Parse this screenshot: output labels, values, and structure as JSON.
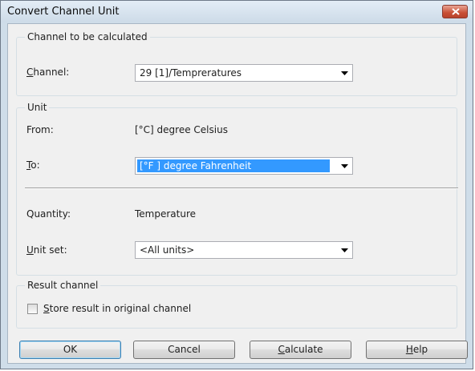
{
  "window": {
    "title": "Convert Channel Unit"
  },
  "channel_group": {
    "legend": "Channel to be calculated",
    "channel_label_key": "C",
    "channel_label_rest": "hannel:",
    "channel_value": "29 [1]/Tempreratures"
  },
  "unit_group": {
    "legend": "Unit",
    "from_label": "From:",
    "from_value": "[°C]  degree Celsius",
    "to_label_key": "T",
    "to_label_rest": "o:",
    "to_value": "[°F ] degree Fahrenheit",
    "quantity_label": "Quantity:",
    "quantity_value": "Temperature",
    "unit_set_label_key": "U",
    "unit_set_label_rest": "nit set:",
    "unit_set_value": "<All units>"
  },
  "result_group": {
    "legend": "Result channel",
    "store_key": "S",
    "store_rest": "tore result in original channel",
    "store_checked": false
  },
  "buttons": {
    "ok": "OK",
    "cancel": "Cancel",
    "calculate_key": "C",
    "calculate_rest": "alculate",
    "help_key": "H",
    "help_rest": "elp"
  },
  "colors": {
    "selection": "#3399ff",
    "close_button": "#c84f35"
  },
  "icons": {
    "close": "close-x-icon",
    "dropdown": "chevron-down-icon"
  }
}
